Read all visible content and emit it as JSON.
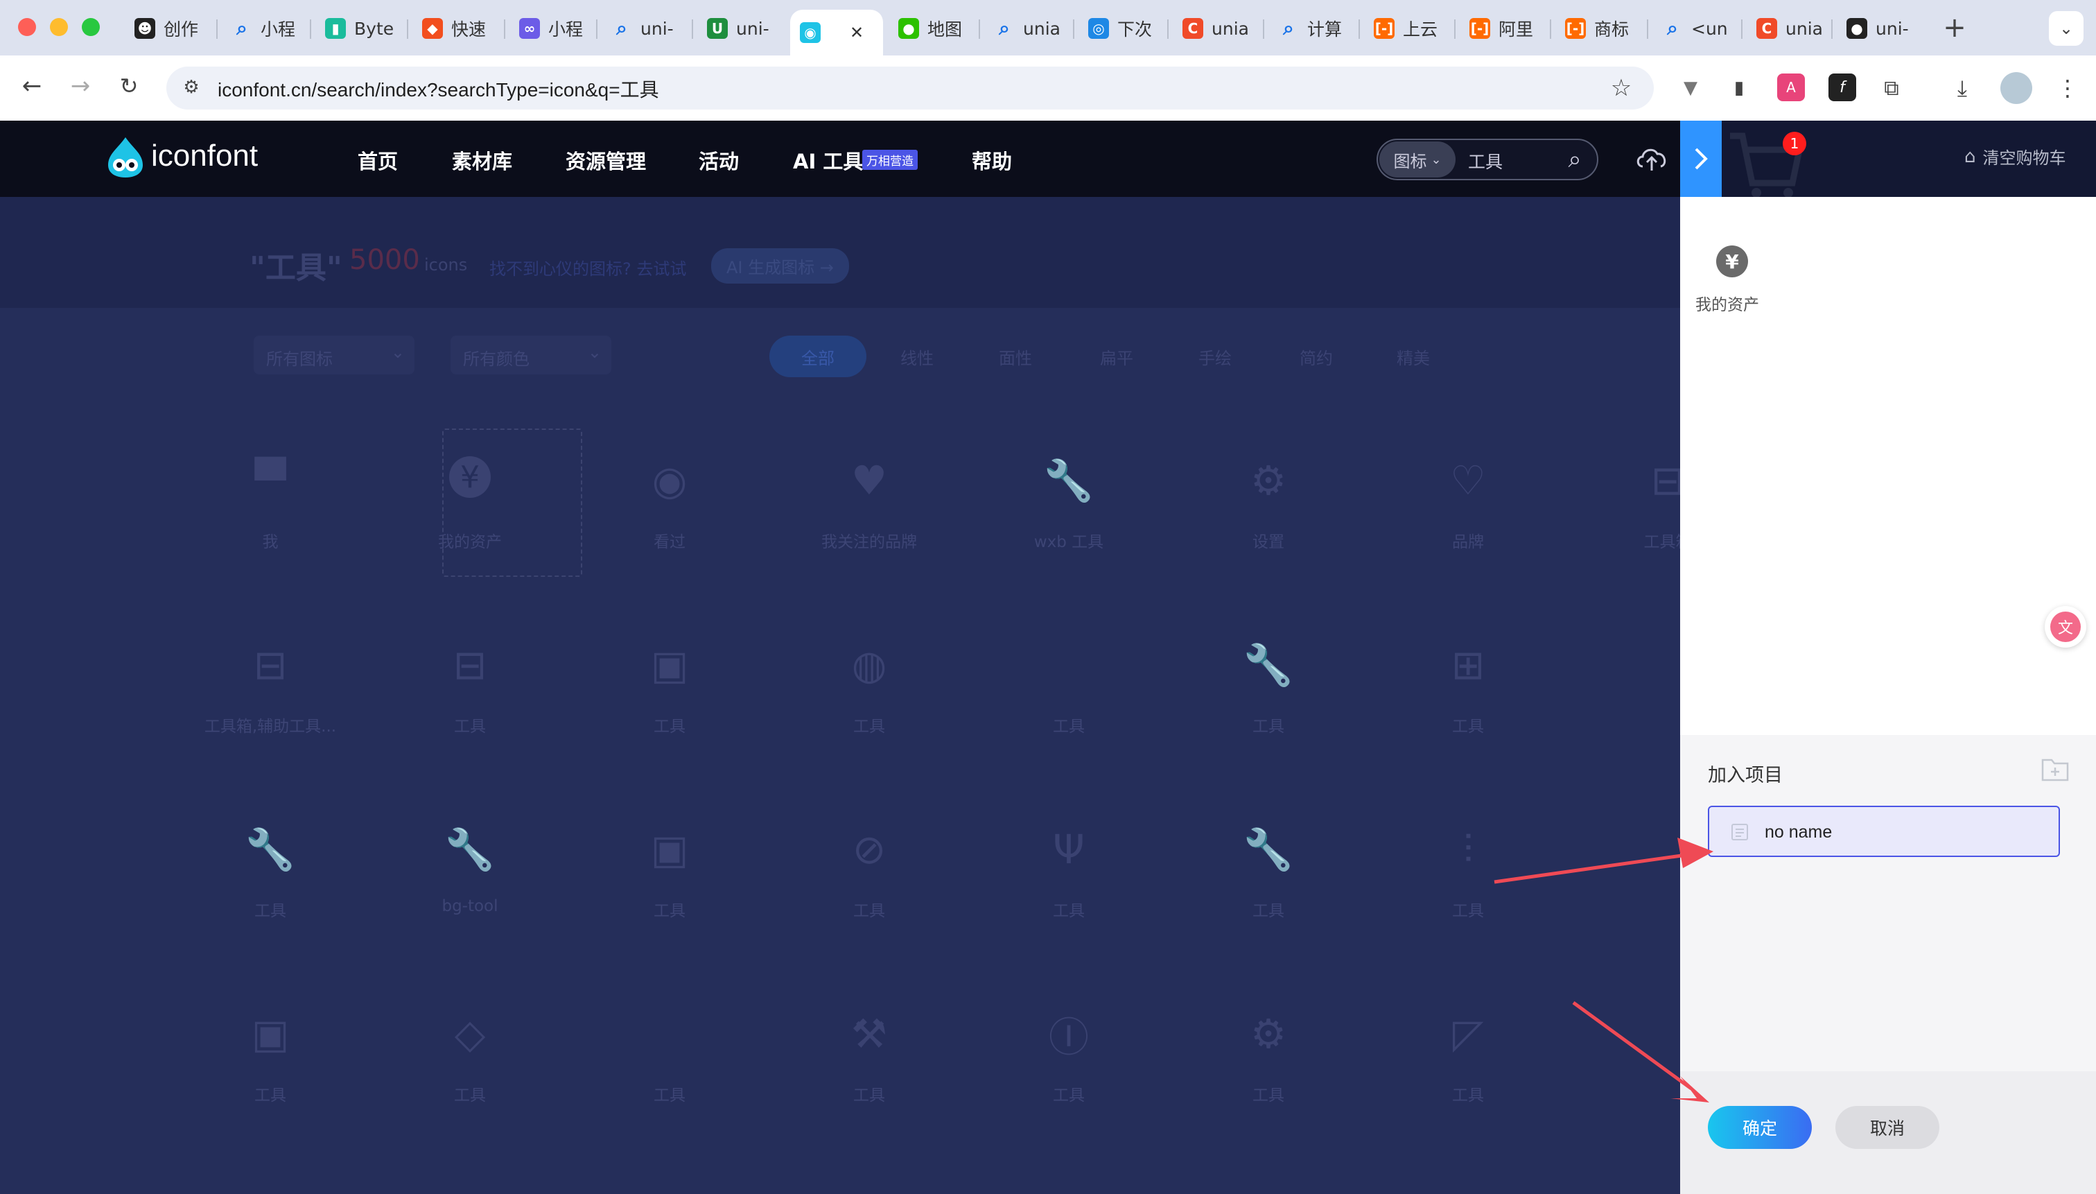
{
  "browser": {
    "tabs": [
      {
        "title": "创作",
        "fav": "robot-icon"
      },
      {
        "title": "小程",
        "fav": "search-icon"
      },
      {
        "title": "Byte",
        "fav": "bytedance-icon"
      },
      {
        "title": "快速",
        "fav": "figma-icon"
      },
      {
        "title": "小程",
        "fav": "link-icon"
      },
      {
        "title": "uni-",
        "fav": "search-icon"
      },
      {
        "title": "uni-",
        "fav": "u-icon"
      },
      {
        "title": "",
        "fav": "iconfont-icon"
      },
      {
        "title": "地图",
        "fav": "wechat-icon"
      },
      {
        "title": "unia",
        "fav": "search-icon"
      },
      {
        "title": "下次",
        "fav": "circle-icon"
      },
      {
        "title": "unia",
        "fav": "c-icon"
      },
      {
        "title": "计算",
        "fav": "search-icon"
      },
      {
        "title": "上云",
        "fav": "bracket-icon"
      },
      {
        "title": "阿里",
        "fav": "bracket-icon"
      },
      {
        "title": "商标",
        "fav": "bracket-icon"
      },
      {
        "title": "<un",
        "fav": "search-icon"
      },
      {
        "title": "unia",
        "fav": "c-icon"
      },
      {
        "title": "uni-",
        "fav": "github-icon"
      }
    ],
    "url": "iconfont.cn/search/index?searchType=icon&q=工具"
  },
  "site": {
    "logo": "iconfont",
    "nav": [
      "首页",
      "素材库",
      "资源管理",
      "活动",
      "AI 工具",
      "帮助"
    ],
    "ai_badge": "万相营造",
    "search_type": "图标",
    "search_value": "工具",
    "cart_count": "1",
    "clear_cart": "清空购物车"
  },
  "results": {
    "query": "\"工具\"",
    "count": "5000",
    "unit": "icons",
    "hint": "找不到心仪的图标? 去试试",
    "ai_button": "AI 生成图标 →",
    "filter1": "所有图标",
    "filter2": "所有颜色",
    "styles": [
      "全部",
      "线性",
      "面性",
      "扁平",
      "手绘",
      "简约",
      "精美"
    ],
    "rows": [
      [
        {
          "label": "我",
          "icon": "cat-icon"
        },
        {
          "label": "我的资产",
          "icon": "yen-icon"
        },
        {
          "label": "看过",
          "icon": "eye-icon"
        },
        {
          "label": "我关注的品牌",
          "icon": "heart-icon"
        },
        {
          "label": "wxb 工具",
          "icon": "wrench-icon"
        },
        {
          "label": "设置",
          "icon": "gear-icon"
        },
        {
          "label": "品牌",
          "icon": "heart-outline-icon"
        },
        {
          "label": "工具箱",
          "icon": "toolbox-icon"
        }
      ],
      [
        {
          "label": "工具箱,辅助工具...",
          "icon": "toolbox-icon"
        },
        {
          "label": "工具",
          "icon": "toolbox-icon"
        },
        {
          "label": "工具",
          "icon": "briefcase-icon"
        },
        {
          "label": "工具",
          "icon": "tool-circle-icon"
        },
        {
          "label": "工具",
          "icon": "blank-icon"
        },
        {
          "label": "工具",
          "icon": "wrench-icon"
        },
        {
          "label": "工具",
          "icon": "kit-icon"
        }
      ],
      [
        {
          "label": "工具",
          "icon": "wrench-icon"
        },
        {
          "label": "bg-tool",
          "icon": "wrench-icon"
        },
        {
          "label": "工具",
          "icon": "briefcase-icon"
        },
        {
          "label": "工具",
          "icon": "bandage-icon"
        },
        {
          "label": "工具",
          "icon": "spanner-icon"
        },
        {
          "label": "工具",
          "icon": "wrench-icon"
        },
        {
          "label": "工具",
          "icon": "fork-knife-icon"
        }
      ],
      [
        {
          "label": "工具",
          "icon": "briefcase-icon"
        },
        {
          "label": "工具",
          "icon": "cube-icon"
        },
        {
          "label": "工具",
          "icon": "blank-icon"
        },
        {
          "label": "工具",
          "icon": "hammer-icon"
        },
        {
          "label": "工具",
          "icon": "it-icon"
        },
        {
          "label": "工具",
          "icon": "gear-icon"
        },
        {
          "label": "工具",
          "icon": "ruler-pen-icon"
        }
      ]
    ]
  },
  "cart_panel": {
    "item_label": "我的资产",
    "item_icon": "yen-icon",
    "add_project_title": "加入项目",
    "project_name": "no name",
    "confirm": "确定",
    "cancel": "取消"
  },
  "colors": {
    "accent": "#4b55e6",
    "confirm_gradient_start": "#19c6ee",
    "confirm_gradient_end": "#3a6cf2",
    "badge": "#ff1d1d",
    "arrow": "#ef4a55"
  }
}
